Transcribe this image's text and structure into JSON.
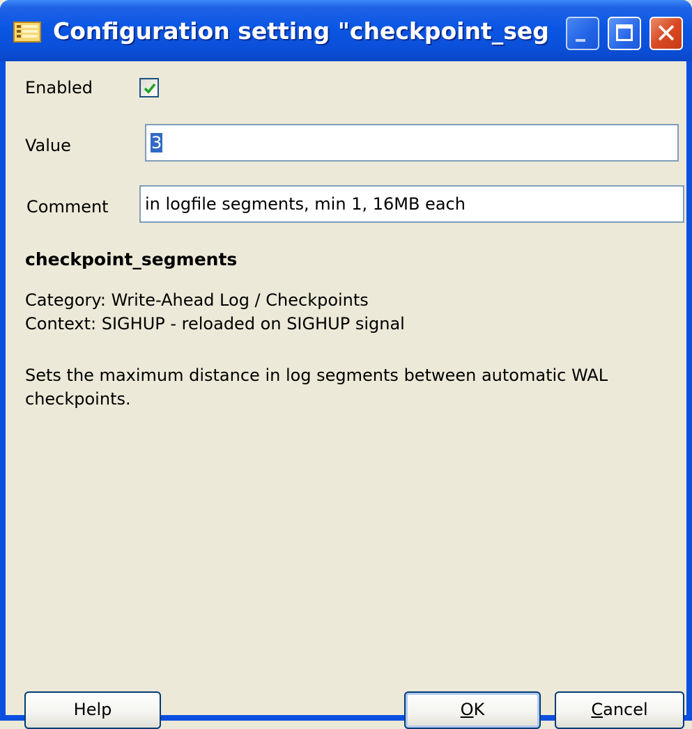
{
  "window": {
    "title": "Configuration setting \"checkpoint_segme...",
    "icon": "config-icon"
  },
  "form": {
    "enabled_label": "Enabled",
    "enabled_checked": true,
    "value_label": "Value",
    "value": "3",
    "comment_label": "Comment",
    "comment": "in logfile segments, min 1, 16MB each"
  },
  "info": {
    "name": "checkpoint_segments",
    "category": "Category: Write-Ahead Log / Checkpoints",
    "context": "Context: SIGHUP - reloaded on SIGHUP signal",
    "description_line1": "Sets the maximum distance in log segments between automatic WAL",
    "description_line2": "checkpoints."
  },
  "buttons": {
    "help": "Help",
    "ok_mnemonic": "O",
    "ok_rest": "K",
    "cancel_mnemonic": "C",
    "cancel_rest": "ancel"
  },
  "colors": {
    "title_bar": "#0a56e4",
    "dialog_bg": "#ece9d8",
    "close_button": "#d94a24",
    "selection": "#316ac5"
  }
}
